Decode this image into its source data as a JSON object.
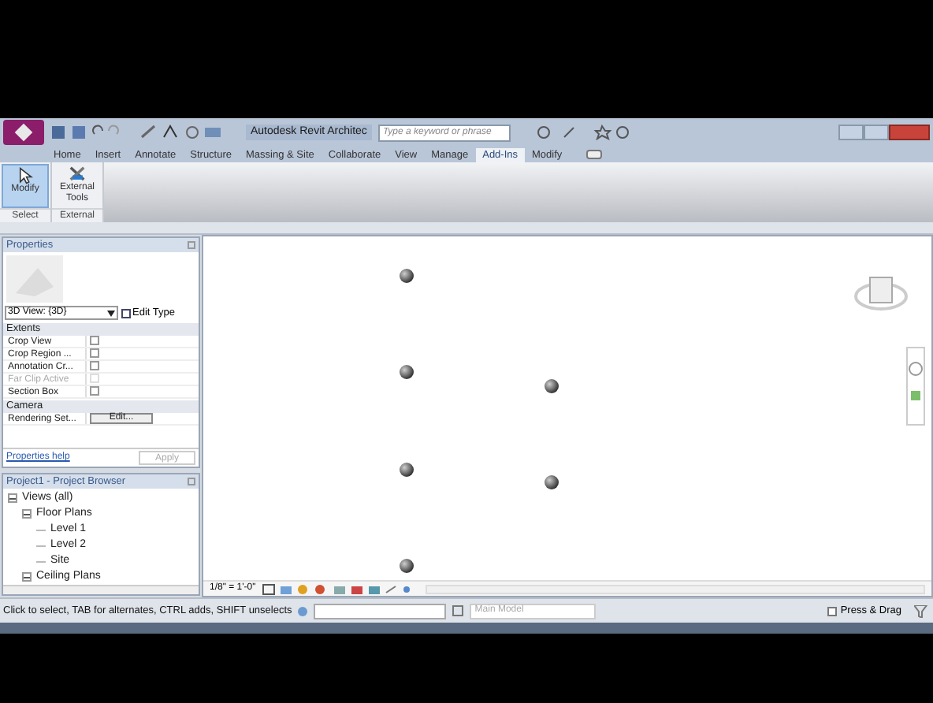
{
  "title_bar": {
    "title": "Autodesk Revit Architec",
    "search_placeholder": "Type a keyword or phrase"
  },
  "ribbon_tabs": [
    {
      "label": "Home",
      "selected": false
    },
    {
      "label": "Insert",
      "selected": false
    },
    {
      "label": "Annotate",
      "selected": false
    },
    {
      "label": "Structure",
      "selected": false
    },
    {
      "label": "Massing & Site",
      "selected": false
    },
    {
      "label": "Collaborate",
      "selected": false
    },
    {
      "label": "View",
      "selected": false
    },
    {
      "label": "Manage",
      "selected": false
    },
    {
      "label": "Add-Ins",
      "selected": true
    },
    {
      "label": "Modify",
      "selected": false
    }
  ],
  "ribbon_panels": [
    {
      "label": "Select",
      "tools": [
        {
          "label": "Modify",
          "kind": "cursor",
          "selected": true
        }
      ]
    },
    {
      "label": "External",
      "tools": [
        {
          "label": "External Tools",
          "kind": "tools",
          "selected": false
        }
      ]
    }
  ],
  "properties": {
    "title": "Properties",
    "type_selector": "3D View: {3D}",
    "edit_type": "Edit Type",
    "groups": [
      {
        "name": "Extents",
        "rows": [
          {
            "label": "Crop View",
            "kind": "checkbox",
            "checked": false,
            "disabled": false
          },
          {
            "label": "Crop Region ...",
            "kind": "checkbox",
            "checked": false,
            "disabled": false
          },
          {
            "label": "Annotation Cr...",
            "kind": "checkbox",
            "checked": false,
            "disabled": false
          },
          {
            "label": "Far Clip Active",
            "kind": "checkbox",
            "checked": false,
            "disabled": true
          },
          {
            "label": "Section Box",
            "kind": "checkbox",
            "checked": false,
            "disabled": false
          }
        ]
      },
      {
        "name": "Camera",
        "rows": [
          {
            "label": "Rendering Set...",
            "kind": "button",
            "value": "Edit...",
            "disabled": false
          }
        ]
      }
    ],
    "help": "Properties help",
    "apply": {
      "label": "Apply",
      "disabled": true
    }
  },
  "project_browser": {
    "title": "Project1 - Project Browser",
    "tree": [
      {
        "label": "Views (all)",
        "expanded": true,
        "children": [
          {
            "label": "Floor Plans",
            "expanded": true,
            "children": [
              {
                "label": "Level 1"
              },
              {
                "label": "Level 2"
              },
              {
                "label": "Site"
              }
            ]
          },
          {
            "label": "Ceiling Plans",
            "expanded": true
          }
        ]
      }
    ]
  },
  "view_control_bar": {
    "scale": "1/8\" = 1'-0\""
  },
  "status_bar": {
    "message": "Click to select, TAB for alternates, CTRL adds, SHIFT unselects",
    "workset": "Main Model",
    "press_drag": {
      "label": "Press & Drag",
      "checked": false
    }
  }
}
